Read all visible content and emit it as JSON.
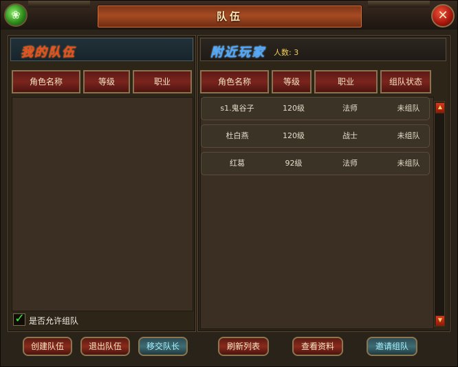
{
  "window": {
    "title": "队伍",
    "logo_icon": "jade-orb-icon",
    "close_label": "✕"
  },
  "my_team": {
    "title": "我的队伍",
    "columns": [
      "角色名称",
      "等级",
      "职业"
    ],
    "members": [],
    "allow_team_label": "是否允许组队",
    "allow_team_checked": true
  },
  "nearby": {
    "title": "附近玩家",
    "count_label": "人数: 3",
    "columns": [
      "角色名称",
      "等级",
      "职业",
      "组队状态"
    ],
    "players": [
      {
        "name": "s1.鬼谷子",
        "level": "120级",
        "class": "法师",
        "status": "未组队"
      },
      {
        "name": "杜白燕",
        "level": "120级",
        "class": "战士",
        "status": "未组队"
      },
      {
        "name": "红葛",
        "level": "92级",
        "class": "法师",
        "status": "未组队"
      }
    ]
  },
  "buttons": {
    "create": "创建队伍",
    "leave": "退出队伍",
    "transfer": "移交队长",
    "refresh": "刷新列表",
    "view": "查看资料",
    "invite": "邀请组队"
  },
  "colors": {
    "accent_red": "#7a241d",
    "accent_teal": "#3e6d74",
    "gold": "#f2d05a"
  }
}
